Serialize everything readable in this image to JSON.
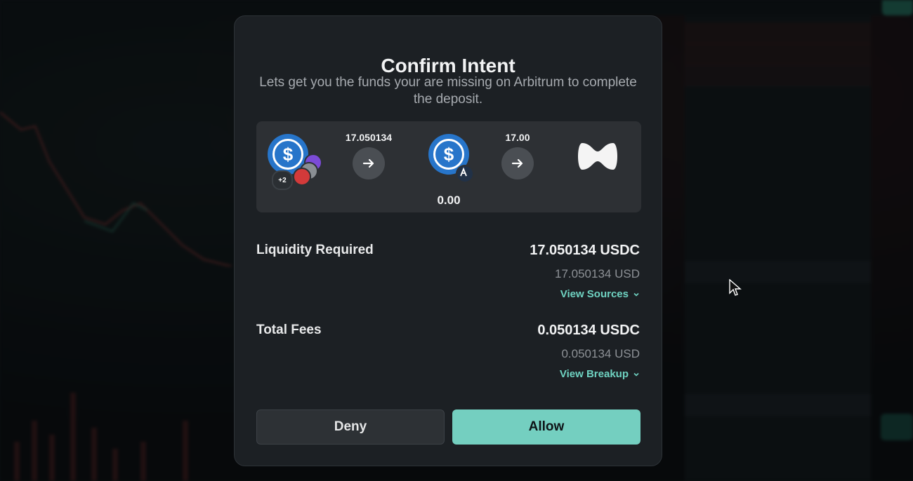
{
  "modal": {
    "title": "Confirm Intent",
    "subtitle": "Lets get you the funds your are missing on Arbitrum to complete the deposit."
  },
  "flow": {
    "source_badge": "+2",
    "amount_in": "17.050134",
    "mid_balance": "0.00",
    "amount_out": "17.00",
    "source_icon": "usdc-icon",
    "mid_icon": "usdc-icon",
    "mid_chain_icon": "arbitrum-icon",
    "dest_icon": "protocol-logo-icon",
    "arrow_icon": "arrow-right-icon"
  },
  "liquidity": {
    "label": "Liquidity Required",
    "value": "17.050134 USDC",
    "usd": "17.050134 USD",
    "link": "View Sources"
  },
  "fees": {
    "label": "Total Fees",
    "value": "0.050134 USDC",
    "usd": "0.050134 USD",
    "link": "View Breakup"
  },
  "actions": {
    "deny": "Deny",
    "allow": "Allow"
  },
  "colors": {
    "modal_bg": "#1c2024",
    "panel_bg": "#2d3034",
    "accent": "#74cfc0",
    "link": "#6fd3c2",
    "usdc": "#2775ca"
  }
}
